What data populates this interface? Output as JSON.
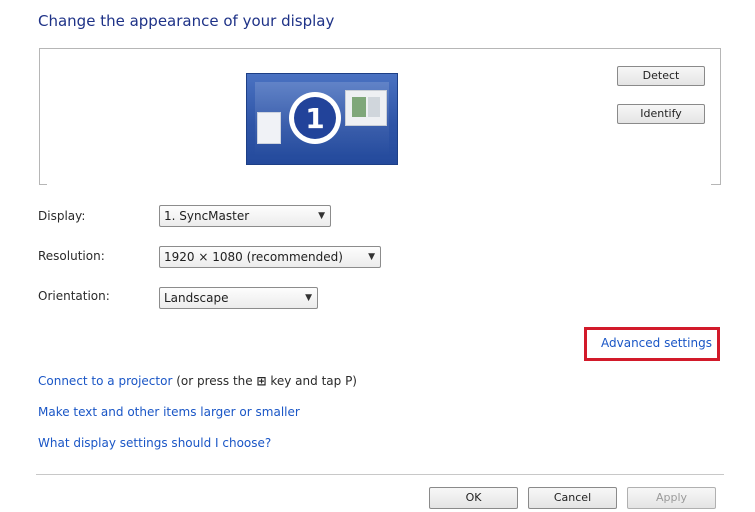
{
  "page": {
    "heading": "Change the appearance of your display"
  },
  "preview": {
    "monitor_number": "1",
    "detect_label": "Detect",
    "identify_label": "Identify"
  },
  "settings": {
    "display_label": "Display:",
    "display_value": "1. SyncMaster",
    "resolution_label": "Resolution:",
    "resolution_value": "1920 × 1080 (recommended)",
    "orientation_label": "Orientation:",
    "orientation_value": "Landscape"
  },
  "advanced_settings_label": "Advanced settings",
  "links": {
    "projector_link": "Connect to a projector",
    "projector_text": " (or press the ",
    "win_key": "⊞",
    "projector_text_end": " key and tap P)",
    "text_size": "Make text and other items larger or smaller",
    "which_settings": "What display settings should I choose?"
  },
  "footer": {
    "ok_label": "OK",
    "cancel_label": "Cancel",
    "apply_label": "Apply"
  },
  "colors": {
    "heading": "#1e3287",
    "link": "#1a56c6",
    "highlight": "#d21a2a",
    "monitor": "#2f55a7"
  }
}
